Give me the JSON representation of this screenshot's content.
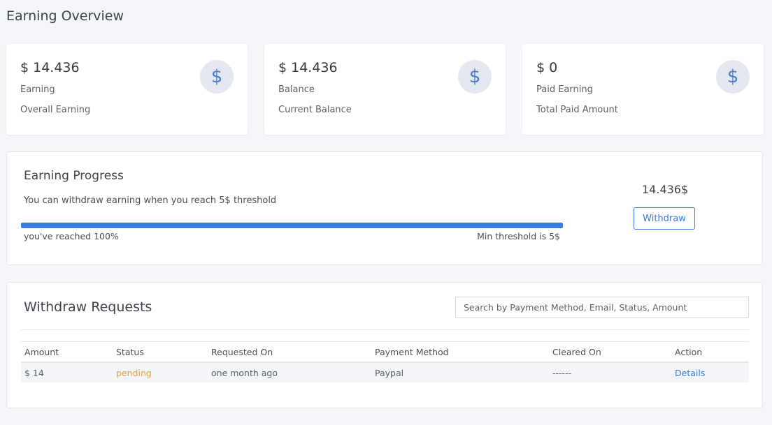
{
  "page": {
    "title": "Earning Overview"
  },
  "cards": [
    {
      "amount": "$ 14.436",
      "label": "Earning",
      "sublabel": "Overall Earning",
      "icon": "dollar-icon"
    },
    {
      "amount": "$ 14.436",
      "label": "Balance",
      "sublabel": "Current Balance",
      "icon": "dollar-icon"
    },
    {
      "amount": "$ 0",
      "label": "Paid Earning",
      "sublabel": "Total Paid Amount",
      "icon": "dollar-icon"
    }
  ],
  "progress": {
    "title": "Earning Progress",
    "description": "You can withdraw earning when you reach 5$ threshold",
    "reached_text": "you've reached 100%",
    "min_text": "Min threshold is 5$",
    "amount": "14.436$",
    "withdraw_label": "Withdraw",
    "percent": 100
  },
  "requests": {
    "title": "Withdraw Requests",
    "search_placeholder": "Search by Payment Method, Email, Status, Amount",
    "columns": [
      "Amount",
      "Status",
      "Requested On",
      "Payment Method",
      "Cleared On",
      "Action"
    ],
    "rows": [
      {
        "amount": "$ 14",
        "status": "pending",
        "requested_on": "one month ago",
        "payment_method": "Paypal",
        "cleared_on": "------",
        "action": "Details"
      }
    ]
  },
  "colors": {
    "accent": "#3a7be0",
    "pending": "#e3a13a",
    "icon_bg": "#e3e8f0"
  }
}
